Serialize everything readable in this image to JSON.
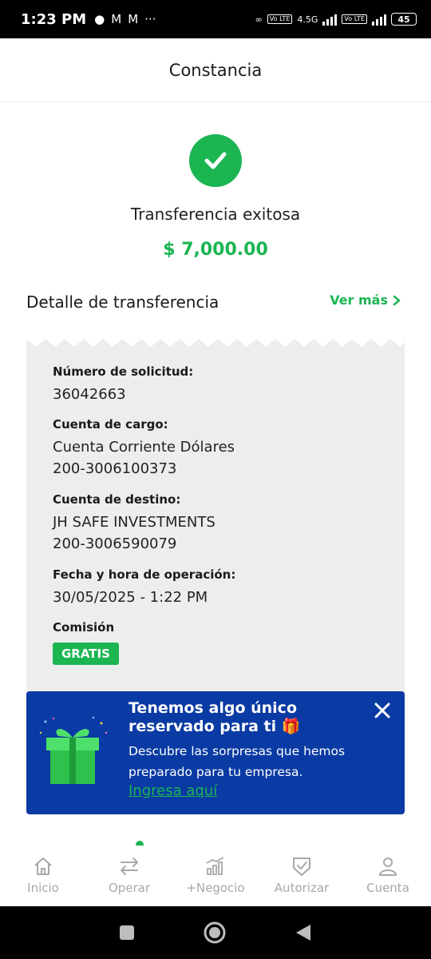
{
  "status_bar": {
    "time": "1:23 PM",
    "network": "4.5G",
    "lte": "Vo LTE",
    "battery": "45"
  },
  "header": {
    "title": "Constancia"
  },
  "result": {
    "message": "Transferencia exitosa",
    "amount": "$ 7,000.00"
  },
  "detail": {
    "title": "Detalle de transferencia",
    "ver_mas": "Ver más",
    "request_number_label": "Número de solicitud:",
    "request_number": "36042663",
    "source_label": "Cuenta de cargo:",
    "source_name": "Cuenta Corriente Dólares",
    "source_number": "200-3006100373",
    "dest_label": "Cuenta de destino:",
    "dest_name": "JH SAFE INVESTMENTS",
    "dest_number": "200-3006590079",
    "date_label": "Fecha y hora de operación:",
    "date_value": "30/05/2025 - 1:22 PM",
    "fee_label": "Comisión",
    "fee_value": "GRATIS"
  },
  "promo": {
    "title": "Tenemos algo único reservado para ti 🎁",
    "description": "Descubre las sorpresas que hemos preparado para tu empresa.",
    "link": "Ingresa aquí"
  },
  "bottom_nav": {
    "items": [
      {
        "label": "Inicio",
        "icon": "home-icon"
      },
      {
        "label": "Operar",
        "icon": "transfer-arrows-icon"
      },
      {
        "label": "+Negocio",
        "icon": "growth-chart-icon"
      },
      {
        "label": "Autorizar",
        "icon": "shield-check-icon"
      },
      {
        "label": "Cuenta",
        "icon": "user-icon"
      }
    ]
  },
  "colors": {
    "accent_green": "#1bb552",
    "promo_blue": "#0a3aa3",
    "receipt_gray": "#eceeed"
  }
}
